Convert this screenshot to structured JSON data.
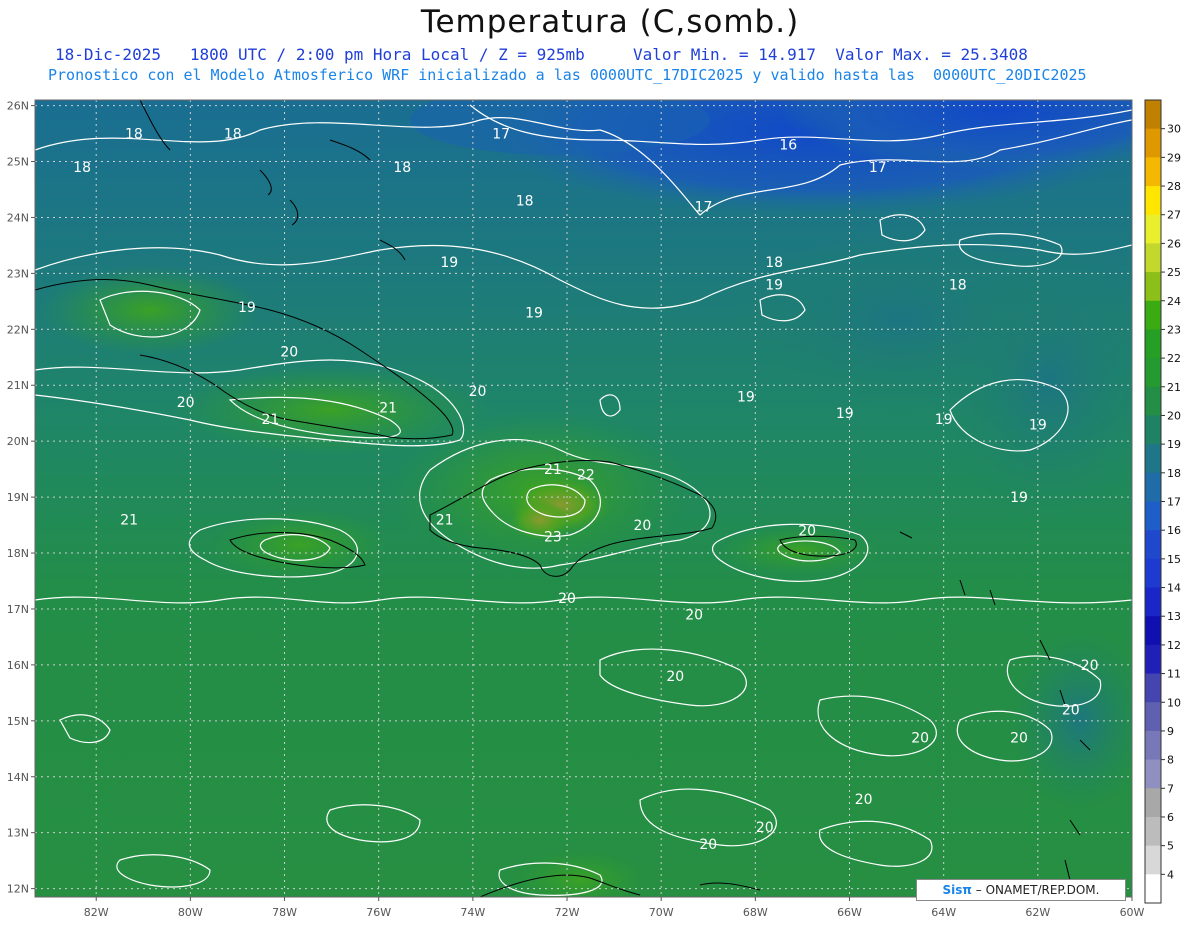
{
  "title": "Temperatura (C,somb.)",
  "subtitle_line1": "18-Dic-2025   1800 UTC / 2:00 pm Hora Local / Z = 925mb     Valor Min. = 14.917  Valor Max. = 25.3408",
  "subtitle_line2": "Pronostico con el Modelo Atmosferico WRF inicializado a las 0000UTC_17DIC2025 y valido hasta las  0000UTC_20DIC2025",
  "credit_logo": "Sisπ",
  "credit_text": "– ONAMET/REP.DOM.",
  "map": {
    "lon_labels": [
      "82W",
      "80W",
      "78W",
      "76W",
      "74W",
      "72W",
      "70W",
      "68W",
      "66W",
      "64W",
      "62W",
      "60W"
    ],
    "lat_labels": [
      "26N",
      "25N",
      "24N",
      "23N",
      "22N",
      "21N",
      "20N",
      "19N",
      "18N",
      "17N",
      "16N",
      "15N",
      "14N",
      "13N",
      "12N"
    ],
    "contour_labels": [
      {
        "text": "18",
        "lon": -81.2,
        "lat": 25.5
      },
      {
        "text": "18",
        "lon": -79.1,
        "lat": 25.5
      },
      {
        "text": "18",
        "lon": -82.3,
        "lat": 24.9
      },
      {
        "text": "18",
        "lon": -75.5,
        "lat": 24.9
      },
      {
        "text": "17",
        "lon": -73.4,
        "lat": 25.5
      },
      {
        "text": "16",
        "lon": -67.3,
        "lat": 25.3
      },
      {
        "text": "17",
        "lon": -65.4,
        "lat": 24.9
      },
      {
        "text": "18",
        "lon": -72.9,
        "lat": 24.3
      },
      {
        "text": "17",
        "lon": -69.1,
        "lat": 24.2
      },
      {
        "text": "19",
        "lon": -74.5,
        "lat": 23.2
      },
      {
        "text": "18",
        "lon": -67.6,
        "lat": 23.2
      },
      {
        "text": "18",
        "lon": -63.7,
        "lat": 22.8
      },
      {
        "text": "19",
        "lon": -67.6,
        "lat": 22.8
      },
      {
        "text": "19",
        "lon": -78.8,
        "lat": 22.4
      },
      {
        "text": "19",
        "lon": -72.7,
        "lat": 22.3
      },
      {
        "text": "20",
        "lon": -77.9,
        "lat": 21.6
      },
      {
        "text": "19",
        "lon": -68.2,
        "lat": 20.8
      },
      {
        "text": "20",
        "lon": -73.9,
        "lat": 20.9
      },
      {
        "text": "20",
        "lon": -80.1,
        "lat": 20.7
      },
      {
        "text": "21",
        "lon": -75.8,
        "lat": 20.6
      },
      {
        "text": "21",
        "lon": -78.3,
        "lat": 20.4
      },
      {
        "text": "19",
        "lon": -66.1,
        "lat": 20.5
      },
      {
        "text": "19",
        "lon": -64.0,
        "lat": 20.4
      },
      {
        "text": "19",
        "lon": -62.0,
        "lat": 20.3
      },
      {
        "text": "21",
        "lon": -72.3,
        "lat": 19.5
      },
      {
        "text": "22",
        "lon": -71.6,
        "lat": 19.4
      },
      {
        "text": "19",
        "lon": -62.4,
        "lat": 19.0
      },
      {
        "text": "21",
        "lon": -81.3,
        "lat": 18.6
      },
      {
        "text": "21",
        "lon": -74.6,
        "lat": 18.6
      },
      {
        "text": "20",
        "lon": -70.4,
        "lat": 18.5
      },
      {
        "text": "20",
        "lon": -66.9,
        "lat": 18.4
      },
      {
        "text": "23",
        "lon": -72.3,
        "lat": 18.3
      },
      {
        "text": "20",
        "lon": -72.0,
        "lat": 17.2
      },
      {
        "text": "20",
        "lon": -69.3,
        "lat": 16.9
      },
      {
        "text": "20",
        "lon": -60.9,
        "lat": 16.0
      },
      {
        "text": "20",
        "lon": -69.7,
        "lat": 15.8
      },
      {
        "text": "20",
        "lon": -61.3,
        "lat": 15.2
      },
      {
        "text": "20",
        "lon": -64.5,
        "lat": 14.7
      },
      {
        "text": "20",
        "lon": -62.4,
        "lat": 14.7
      },
      {
        "text": "20",
        "lon": -65.7,
        "lat": 13.6
      },
      {
        "text": "20",
        "lon": -67.8,
        "lat": 13.1
      },
      {
        "text": "20",
        "lon": -69.0,
        "lat": 12.8
      }
    ]
  },
  "colorbar": {
    "levels": [
      "30",
      "29",
      "28",
      "27",
      "26",
      "25",
      "24",
      "23",
      "22",
      "21",
      "20",
      "19",
      "18",
      "17",
      "16",
      "15",
      "14",
      "13",
      "12",
      "11",
      "10",
      "9",
      "8",
      "7",
      "6",
      "5",
      "4"
    ],
    "colors": [
      "#c08000",
      "#e09800",
      "#f5b800",
      "#ffe600",
      "#e8ef2c",
      "#c2d82c",
      "#8cbf18",
      "#3aab12",
      "#25a024",
      "#259a30",
      "#238e46",
      "#1f8264",
      "#1f7688",
      "#1f6ca8",
      "#1f5ec8",
      "#1f48cc",
      "#1f3ad0",
      "#1a26c8",
      "#1010b0",
      "#2020b8",
      "#4545b0",
      "#6060b0",
      "#7878b8",
      "#9090c0",
      "#a8a8a8",
      "#bcbcbc",
      "#d8d8d8",
      "#ffffff"
    ]
  },
  "colors": {
    "water_blue": "#1148c8",
    "cool_teal": "#1c6e95",
    "mid_teal": "#1f8670",
    "green": "#238e46",
    "warm_green": "#37a028",
    "peak_olive": "#7aa32a",
    "grid": "#cccccc"
  }
}
